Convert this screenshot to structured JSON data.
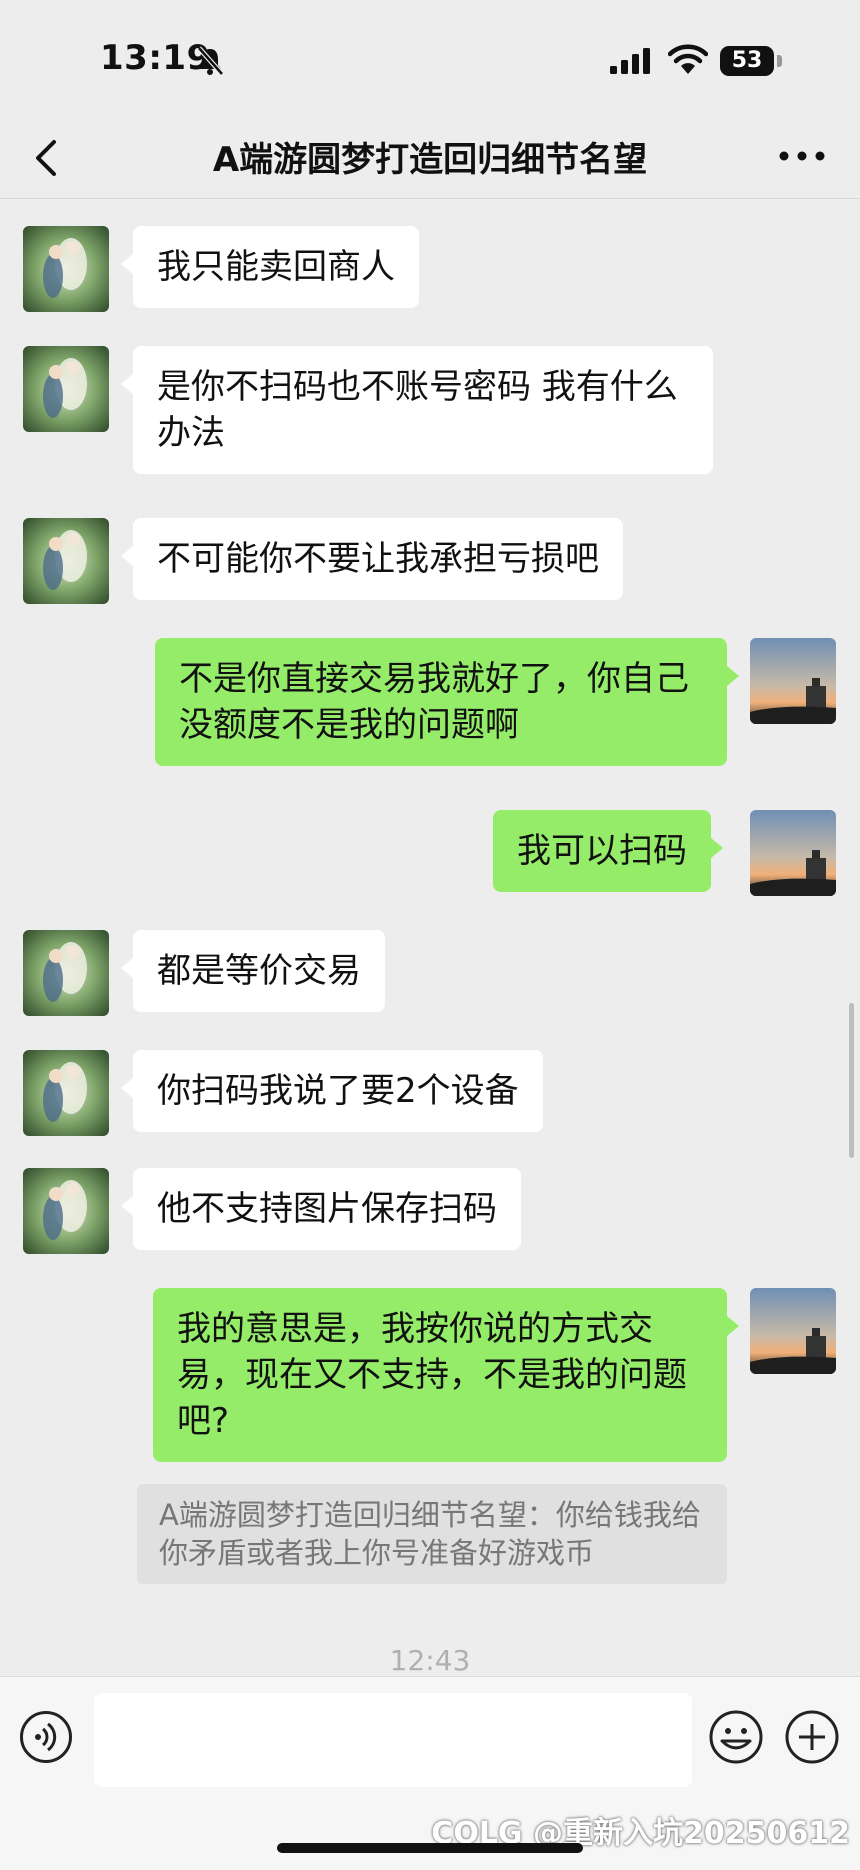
{
  "status_bar": {
    "time": "13:19",
    "battery": "53"
  },
  "header": {
    "title": "A端游圆梦打造回归细节名望"
  },
  "messages": [
    {
      "side": "left",
      "text": "我只能卖回商人"
    },
    {
      "side": "left",
      "text": "是你不扫码也不账号密码 我有什么办法"
    },
    {
      "side": "left",
      "text": "不可能你不要让我承担亏损吧"
    },
    {
      "side": "right",
      "text": "不是你直接交易我就好了，你自己没额度不是我的问题啊"
    },
    {
      "side": "right",
      "text": "我可以扫码"
    },
    {
      "side": "left",
      "text": "都是等价交易"
    },
    {
      "side": "left",
      "text": "你扫码我说了要2个设备"
    },
    {
      "side": "left",
      "text": "他不支持图片保存扫码"
    },
    {
      "side": "right",
      "text": "我的意思是，我按你说的方式交易，现在又不支持，不是我的问题吧?"
    }
  ],
  "quote": {
    "text": "A端游圆梦打造回归细节名望：你给钱我给你矛盾或者我上你号准备好游戏币"
  },
  "timestamp": "12:43",
  "input": {
    "value": ""
  },
  "watermark": "COLG @重新入坑20250612",
  "icons": {
    "back": "chevron-left-icon",
    "more": "ellipsis-icon",
    "voice": "voice-icon",
    "emoji": "emoji-icon",
    "plus": "plus-icon"
  },
  "colors": {
    "background": "#ededed",
    "bubble_self": "#95ec69",
    "bubble_other": "#ffffff"
  }
}
